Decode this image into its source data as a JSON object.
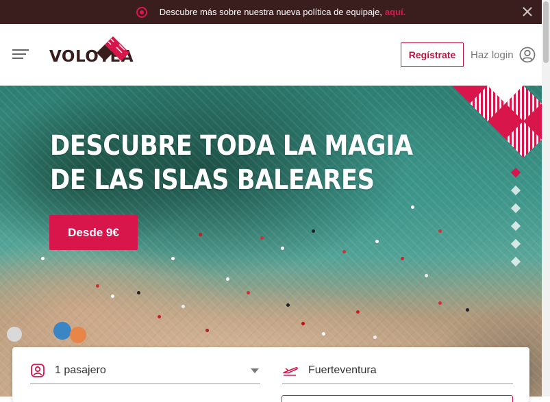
{
  "banner": {
    "text": "Descubre más sobre nuestra nueva política de equipaje,",
    "link": "aquí."
  },
  "header": {
    "brand": "VOLOTEA",
    "register_label": "Regístrate",
    "login_label": "Haz login"
  },
  "hero": {
    "title_line1": "DESCUBRE TODA LA MAGIA",
    "title_line2": "DE LAS ISLAS BALEARES",
    "cta_label": "Desde 9€",
    "slide_count": 6,
    "active_slide": 1
  },
  "search": {
    "passengers_value": "1 pasajero",
    "destination_value": "Fuerteventura"
  },
  "icons": {
    "banner": "alert-circle-icon",
    "close": "close-icon",
    "menu": "hamburger-menu-icon",
    "user": "user-icon",
    "passenger": "passenger-icon",
    "plane": "plane-icon"
  },
  "colors": {
    "brand": "#d8164c",
    "banner_bg": "#3a1d1d",
    "register_border": "#b3173f"
  }
}
